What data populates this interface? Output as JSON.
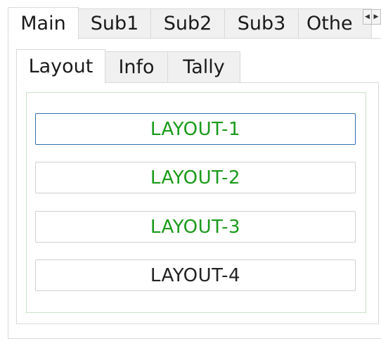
{
  "outer_tabs": {
    "main": "Main",
    "sub1": "Sub1",
    "sub2": "Sub2",
    "sub3": "Sub3",
    "other": "Othe"
  },
  "tab_scroll": {
    "left_arrow": "◀",
    "right_arrow": "▶"
  },
  "inner_tabs": {
    "layout": "Layout",
    "info": "Info",
    "tally": "Tally"
  },
  "layout_buttons": [
    {
      "label": "LAYOUT-1",
      "color": "#1a9a1a",
      "focused": true
    },
    {
      "label": "LAYOUT-2",
      "color": "#1a9a1a",
      "focused": false
    },
    {
      "label": "LAYOUT-3",
      "color": "#1a9a1a",
      "focused": false
    },
    {
      "label": "LAYOUT-4",
      "color": "#222222",
      "focused": false
    }
  ],
  "colors": {
    "active_label": "#1a9a1a",
    "inactive_label": "#222222",
    "focus_border": "#2f6fb0",
    "group_border": "#c9e3c9"
  }
}
